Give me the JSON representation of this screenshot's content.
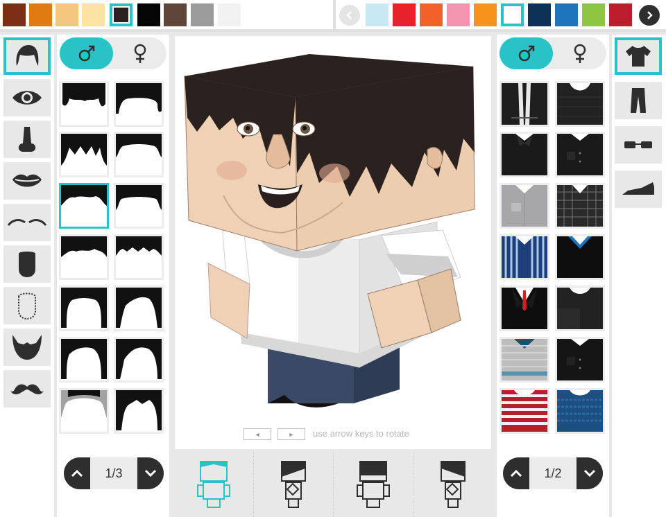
{
  "top_bar": {
    "hair_colors": [
      "#7b2f16",
      "#e07b12",
      "#f5c77e",
      "#fde3a3",
      "#2b2220",
      "#050505",
      "#5e4639",
      "#9b9b9b",
      "#f2f2f2"
    ],
    "hair_selected_index": 4,
    "clothing_colors": [
      "#c8e9f3",
      "#e8212a",
      "#f26128",
      "#f395b1",
      "#f7931d",
      "#ffffff",
      "#0d3157",
      "#1d76bd",
      "#8dc63f",
      "#bb1e2d"
    ],
    "clothing_selected_index": 5,
    "prev_icon": "chevron-left-icon",
    "next_icon": "chevron-right-icon"
  },
  "face_categories": [
    {
      "name": "hair",
      "icon": "hair-icon",
      "selected": true
    },
    {
      "name": "eyes",
      "icon": "eye-icon",
      "selected": false
    },
    {
      "name": "nose",
      "icon": "nose-icon",
      "selected": false
    },
    {
      "name": "mouth",
      "icon": "lips-icon",
      "selected": false
    },
    {
      "name": "eyebrows",
      "icon": "eyebrows-icon",
      "selected": false
    },
    {
      "name": "face-shape",
      "icon": "face-shape-icon",
      "selected": false
    },
    {
      "name": "face-outline",
      "icon": "face-outline-icon",
      "selected": false
    },
    {
      "name": "beard",
      "icon": "beard-icon",
      "selected": false
    },
    {
      "name": "mustache",
      "icon": "mustache-icon",
      "selected": false
    }
  ],
  "left_panel": {
    "gender_selected": "male",
    "male_icon": "male-symbol-icon",
    "female_icon": "female-symbol-icon",
    "selected_item_index": 4,
    "pager_label": "1/3"
  },
  "right_panel": {
    "gender_selected": "male",
    "male_icon": "male-symbol-icon",
    "female_icon": "female-symbol-icon",
    "pager_label": "1/2"
  },
  "body_categories": [
    {
      "name": "shirt",
      "icon": "tshirt-icon",
      "selected": true
    },
    {
      "name": "pants",
      "icon": "pants-icon",
      "selected": false
    },
    {
      "name": "glasses",
      "icon": "glasses-icon",
      "selected": false
    },
    {
      "name": "shoes",
      "icon": "shoe-icon",
      "selected": false
    }
  ],
  "preview": {
    "rotate_hint": "use arrow keys to rotate",
    "left_key": "◄",
    "right_key": "►",
    "views": [
      {
        "name": "front",
        "selected": true
      },
      {
        "name": "side-left",
        "selected": false
      },
      {
        "name": "back",
        "selected": false
      },
      {
        "name": "side-right",
        "selected": false
      }
    ]
  },
  "accent_color": "#29c2c7"
}
